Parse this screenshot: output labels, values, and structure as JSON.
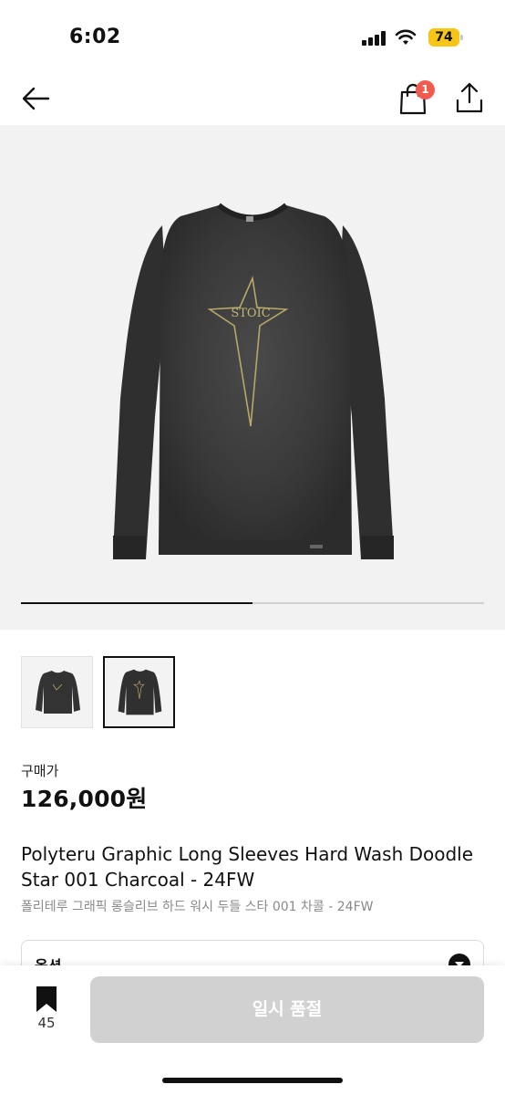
{
  "status_bar": {
    "time": "6:02",
    "battery_level": "74",
    "icons": [
      "cellular-signal-icon",
      "wifi-icon",
      "battery-icon"
    ],
    "battery_color": "#f5c518"
  },
  "nav": {
    "back_icon": "arrow-left-icon",
    "cart_icon": "shopping-bag-icon",
    "cart_badge": "1",
    "share_icon": "share-icon",
    "badge_color": "#f05a4f"
  },
  "gallery": {
    "image_count": 2,
    "current_index": 2,
    "progress_fraction": 0.5,
    "main_image": "charcoal-long-sleeve-tee-with-star-graphic",
    "thumbnails": [
      "thumbnail-1",
      "thumbnail-2"
    ],
    "graphic_text": "STOIC"
  },
  "price": {
    "label": "구매가",
    "value": "126,000원"
  },
  "product": {
    "title": "Polyteru Graphic Long Sleeves Hard Wash Doodle Star 001 Charcoal - 24FW",
    "subtitle": "폴리테루 그래픽 롱슬리브 하드 워시 두들 스타 001 차콜 - 24FW"
  },
  "option": {
    "label": "옵션",
    "icon": "chevron-down-icon"
  },
  "bottom_bar": {
    "bookmark_icon": "bookmark-icon",
    "bookmark_count": "45",
    "buy_label": "일시 품절",
    "buy_color": "#d1d1d1"
  }
}
